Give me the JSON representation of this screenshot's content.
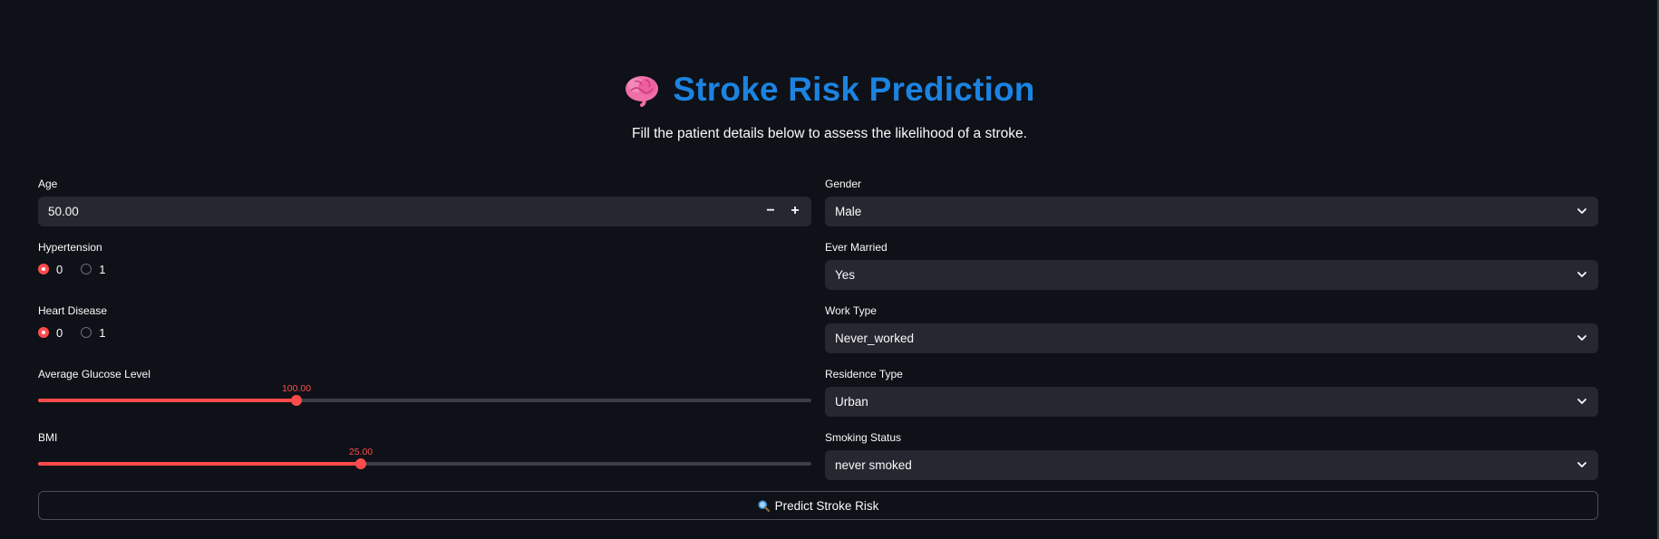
{
  "header": {
    "title": "Stroke Risk Prediction",
    "subtitle": "Fill the patient details below to assess the likelihood of a stroke.",
    "icon": "brain-icon"
  },
  "left": {
    "age": {
      "label": "Age",
      "value": "50.00",
      "minus": "−",
      "plus": "+"
    },
    "hypertension": {
      "label": "Hypertension",
      "options": [
        "0",
        "1"
      ],
      "selected": "0"
    },
    "heart_disease": {
      "label": "Heart Disease",
      "options": [
        "0",
        "1"
      ],
      "selected": "0"
    },
    "glucose": {
      "label": "Average Glucose Level",
      "value_label": "100.00",
      "value": 100.0,
      "fraction": 0.334
    },
    "bmi": {
      "label": "BMI",
      "value_label": "25.00",
      "value": 25.0,
      "fraction": 0.417
    }
  },
  "right": {
    "gender": {
      "label": "Gender",
      "value": "Male"
    },
    "ever_married": {
      "label": "Ever Married",
      "value": "Yes"
    },
    "work_type": {
      "label": "Work Type",
      "value": "Never_worked"
    },
    "residence_type": {
      "label": "Residence Type",
      "value": "Urban"
    },
    "smoking_status": {
      "label": "Smoking Status",
      "value": "never smoked"
    }
  },
  "predict_button": {
    "label": "Predict Stroke Risk",
    "icon": "magnifier-icon"
  },
  "colors": {
    "background": "#0e1117",
    "title": "#1c83e1",
    "accent": "#ff4b4b",
    "input": "#262730"
  }
}
